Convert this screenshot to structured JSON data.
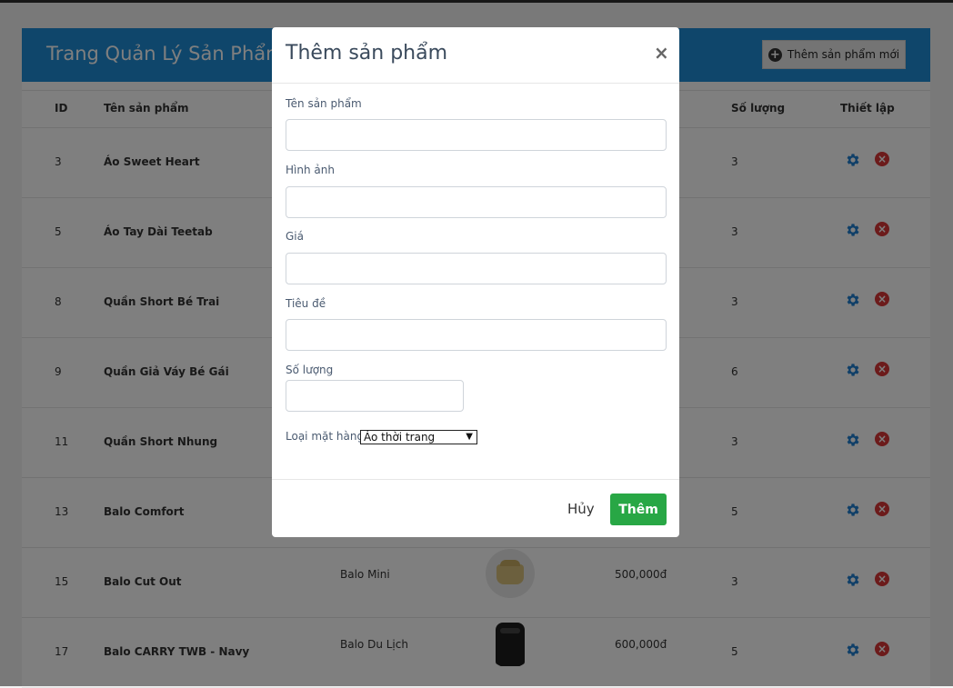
{
  "page": {
    "title": "Trang Quản Lý Sản Phẩm",
    "add_button": "Thêm sản phẩm mới"
  },
  "table": {
    "columns": [
      "ID",
      "Tên sản phẩm",
      "Số lượng",
      "Thiết lập"
    ],
    "rows": [
      {
        "id": "3",
        "name": "Áo Sweet Heart",
        "category": "",
        "price": "",
        "qty": "3"
      },
      {
        "id": "5",
        "name": "Áo Tay Dài Teetab",
        "category": "",
        "price": "",
        "qty": "3"
      },
      {
        "id": "8",
        "name": "Quần Short Bé Trai",
        "category": "",
        "price": "",
        "qty": "3"
      },
      {
        "id": "9",
        "name": "Quần Giả Váy Bé Gái",
        "category": "",
        "price": "",
        "qty": "6"
      },
      {
        "id": "11",
        "name": "Quần Short Nhung",
        "category": "",
        "price": "",
        "qty": "3"
      },
      {
        "id": "13",
        "name": "Balo Comfort",
        "category": "",
        "price": "",
        "qty": "5"
      },
      {
        "id": "15",
        "name": "Balo Cut Out",
        "category": "Balo Mini",
        "price": "500,000đ",
        "qty": "3"
      },
      {
        "id": "17",
        "name": "Balo CARRY TWB - Navy",
        "category": "Balo Du Lịch",
        "price": "600,000đ",
        "qty": "5"
      }
    ]
  },
  "modal": {
    "title": "Thêm sản phẩm",
    "close": "×",
    "fields": {
      "name_label": "Tên sản phẩm",
      "image_label": "Hình ảnh",
      "price_label": "Giá",
      "headline_label": "Tiêu đề",
      "qty_label": "Số lượng",
      "type_label": "Loại mặt hàng",
      "type_selected": "Áo thời trang"
    },
    "cancel": "Hủy",
    "submit": "Thêm"
  },
  "colors": {
    "header": "#1f8cd6",
    "submit": "#28a745",
    "gear": "#1f7fd1",
    "delete": "#d93636"
  }
}
